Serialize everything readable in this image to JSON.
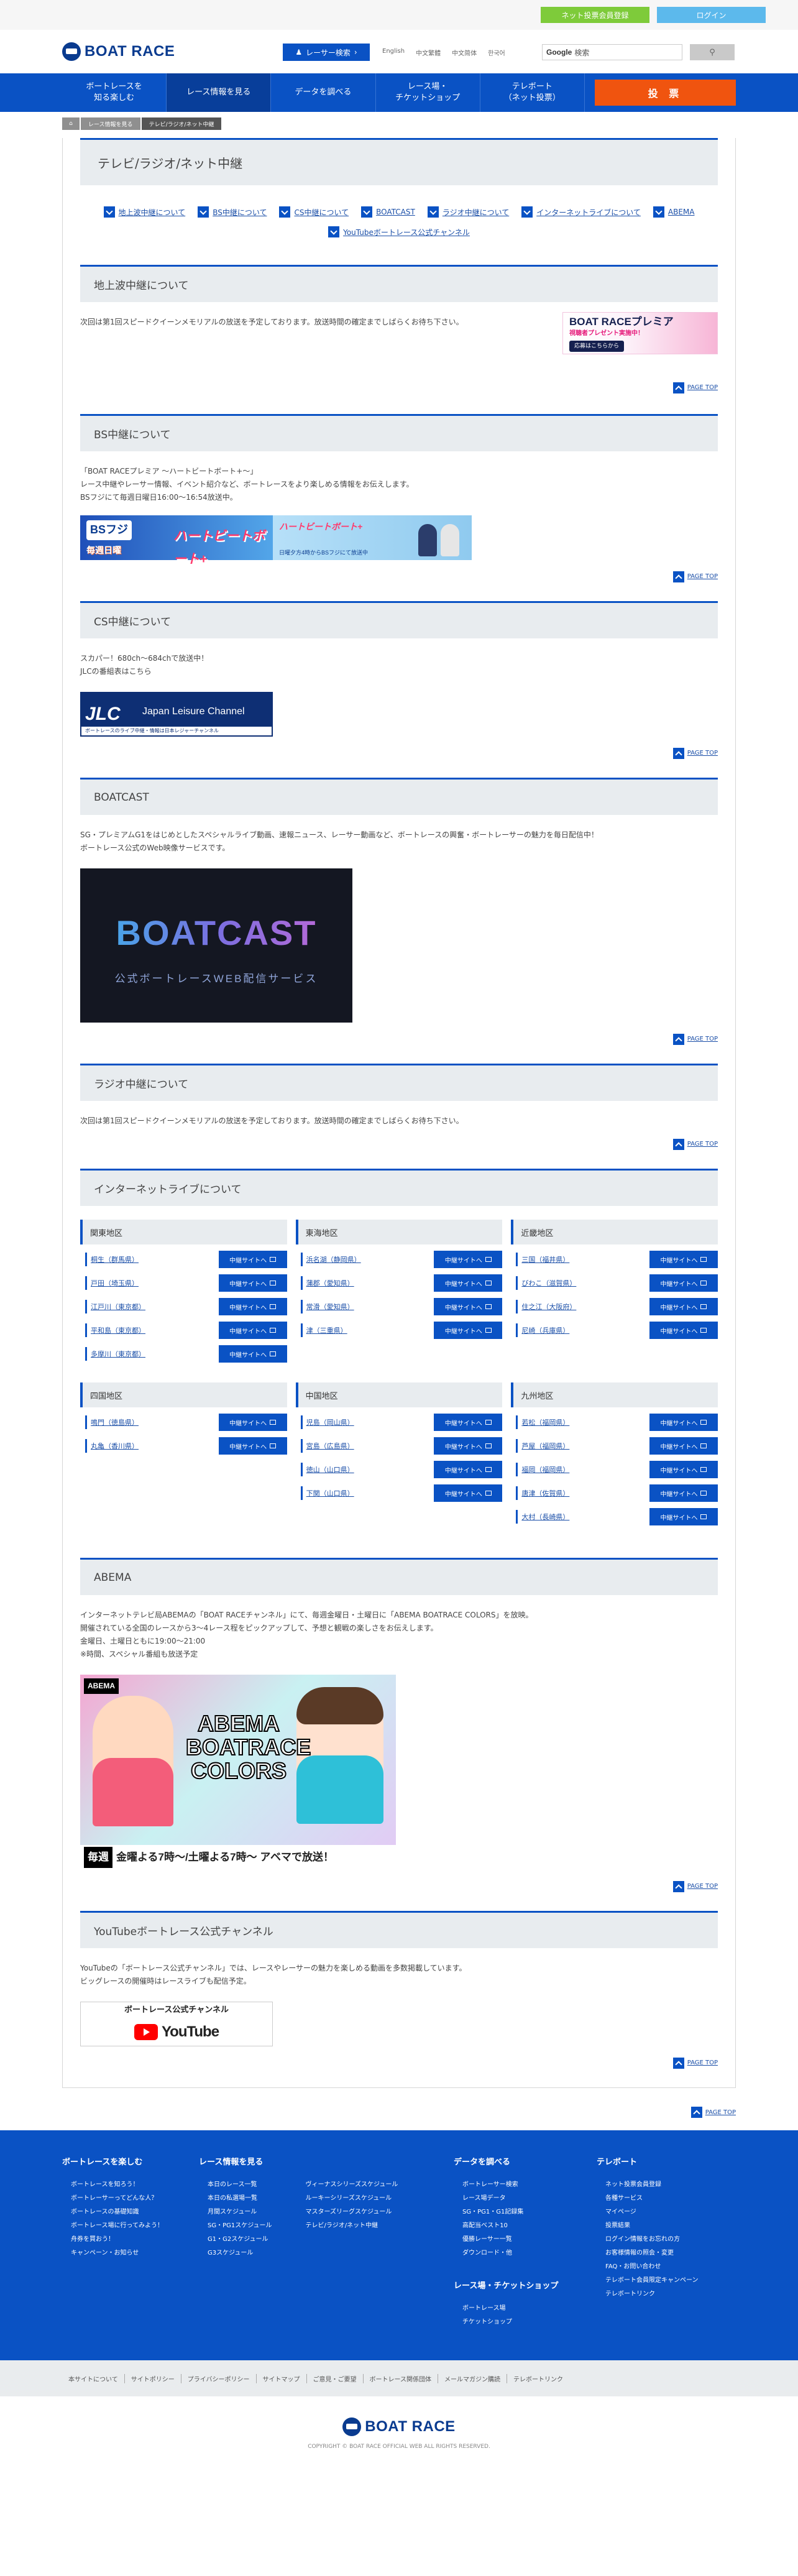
{
  "topbar": {
    "register": "ネット投票会員登録",
    "login": "ログイン"
  },
  "header": {
    "logo": "BOAT RACE",
    "racer_search": "レーサー検索",
    "langs": [
      "English",
      "中文繁體",
      "中文简体",
      "한국어"
    ],
    "google": "Google",
    "search_placeholder": "検索"
  },
  "nav": [
    {
      "label": "ボートレースを\n知る楽しむ"
    },
    {
      "label": "レース情報を見る"
    },
    {
      "label": "データを調べる"
    },
    {
      "label": "レース場・\nチケットショップ"
    },
    {
      "label": "テレボート\n（ネット投票）"
    }
  ],
  "nav_bet": "投 票",
  "breadcrumb": [
    "レース情報を見る",
    "テレビ/ラジオ/ネット中継"
  ],
  "page_title": "テレビ/ラジオ/ネット中継",
  "anchors": [
    "地上波中継について",
    "BS中継について",
    "CS中継について",
    "BOATCAST",
    "ラジオ中継について",
    "インターネットライブについて",
    "ABEMA",
    "YouTubeボートレース公式チャンネル"
  ],
  "page_top": "PAGE TOP",
  "sections": {
    "terrestrial": {
      "title": "地上波中継について",
      "text": "次回は第1回スピードクイーンメモリアルの放送を予定しております。放送時間の確定までしばらくお待ち下さい。",
      "banner": {
        "t1": "BOAT RACEプレミア",
        "t2": "視聴者プレゼント実施中！",
        "t3": "応募はこちらから"
      }
    },
    "bs": {
      "title": "BS中継について",
      "lines": [
        "「BOAT RACEプレミア ～ハートビートボート+～」",
        "レース中継やレーサー情報、イベント紹介など、ボートレースをより楽しめる情報をお伝えします。",
        "BSフジにて毎週日曜日16:00～16:54放送中。"
      ],
      "banner": {
        "bsf": "BSフジ",
        "sub": "毎週日曜",
        "ttl": "ハートビートボート+",
        "ttl2": "ハートビートボート+",
        "sub2": "日曜夕方4時からBSフジにて放送中"
      }
    },
    "cs": {
      "title": "CS中継について",
      "lines": [
        "スカパー！680ch～684chで放送中！",
        "JLCの番組表はこちら"
      ],
      "banner": {
        "mk": "JLC",
        "nm": "Japan Leisure Channel",
        "bar": "ボートレースのライブ中継・情報は日本レジャーチャンネル"
      }
    },
    "boatcast": {
      "title": "BOATCAST",
      "lines": [
        "SG・プレミアムG1をはじめとしたスペシャルライブ動画、速報ニュース、レーサー動画など、ボートレースの興奮・ボートレーサーの魅力を毎日配信中！",
        "ボートレース公式のWeb映像サービスです。"
      ],
      "banner": {
        "t1": "BOATCAST",
        "t2": "公式ボートレースWEB配信サービス"
      }
    },
    "radio": {
      "title": "ラジオ中継について",
      "text": "次回は第1回スピードクイーンメモリアルの放送を予定しております。放送時間の確定までしばらくお待ち下さい。"
    },
    "internet": {
      "title": "インターネットライブについて",
      "button": "中継サイトへ",
      "regions": [
        {
          "name": "関東地区",
          "stadiums": [
            "桐生（群馬県）",
            "戸田（埼玉県）",
            "江戸川（東京都）",
            "平和島（東京都）",
            "多摩川（東京都）"
          ]
        },
        {
          "name": "東海地区",
          "stadiums": [
            "浜名湖（静岡県）",
            "蒲郡（愛知県）",
            "常滑（愛知県）",
            "津（三重県）"
          ]
        },
        {
          "name": "近畿地区",
          "stadiums": [
            "三国（福井県）",
            "びわこ（滋賀県）",
            "住之江（大阪府）",
            "尼崎（兵庫県）"
          ]
        },
        {
          "name": "四国地区",
          "stadiums": [
            "鳴門（徳島県）",
            "丸亀（香川県）"
          ]
        },
        {
          "name": "中国地区",
          "stadiums": [
            "児島（岡山県）",
            "宮島（広島県）",
            "徳山（山口県）",
            "下関（山口県）"
          ]
        },
        {
          "name": "九州地区",
          "stadiums": [
            "若松（福岡県）",
            "芦屋（福岡県）",
            "福岡（福岡県）",
            "唐津（佐賀県）",
            "大村（長崎県）"
          ]
        }
      ]
    },
    "abema": {
      "title": "ABEMA",
      "lines": [
        "インターネットテレビ局ABEMAの「BOAT RACEチャンネル」にて、毎週金曜日・土曜日に「ABEMA BOATRACE COLORS」を放映。",
        "開催されている全国のレースから3～4レース程をピックアップして、予想と観戦の楽しさをお伝えします。",
        "金曜日、土曜日ともに19:00～21:00",
        "※時間、スペシャル番組も放送予定"
      ],
      "banner": {
        "logo": "ABEMA",
        "tt": "ABEMA BOATRACE COLORS",
        "mai": "毎週",
        "strip": "金曜よる7時～/土曜よる7時～ アベマで放送！"
      }
    },
    "youtube": {
      "title": "YouTubeボートレース公式チャンネル",
      "lines": [
        "YouTubeの「ボートレース公式チャンネル」では、レースやレーサーの魅力を楽しめる動画を多数掲載しています。",
        "ビッグレースの開催時はレースライブも配信予定。"
      ],
      "banner": {
        "t1": "ボートレース公式チャンネル",
        "yt": "YouTube"
      }
    }
  },
  "footer": {
    "col1": {
      "title": "ボートレースを楽しむ",
      "items": [
        "ボートレースを知ろう！",
        "ボートレーサーってどんな人？",
        "ボートレースの基礎知識",
        "ボートレース場に行ってみよう！",
        "舟券を買おう！",
        "キャンペーン・お知らせ"
      ]
    },
    "col2": {
      "title": "レース情報を見る",
      "left": [
        "本日のレース一覧",
        "本日の私選場一覧",
        "月間スケジュール",
        "SG・PG1スケジュール",
        "G1・G2スケジュール",
        "G3スケジュール"
      ],
      "right": [
        "ヴィーナスシリーズスケジュール",
        "ルーキーシリーズスケジュール",
        "マスターズリーグスケジュール",
        "テレビ/ラジオ/ネット中継"
      ]
    },
    "col3": {
      "title": "データを調べる",
      "items": [
        "ボートレーサー検索",
        "レース場データ",
        "SG・PG1・G1記録集",
        "高配当ベスト10",
        "優勝レーサー一覧",
        "ダウンロード・他"
      ],
      "title2": "レース場・チケットショップ",
      "items2": [
        "ボートレース場",
        "チケットショップ"
      ]
    },
    "col4": {
      "title": "テレボート",
      "items": [
        "ネット投票会員登録",
        "各種サービス",
        "マイページ",
        "投票結果",
        "ログイン情報をお忘れの方",
        "お客様情報の照会・変更",
        "FAQ・お問い合わせ",
        "テレボート会員限定キャンペーン",
        "テレボートリンク"
      ]
    }
  },
  "subfooter": [
    "本サイトについて",
    "サイトポリシー",
    "プライバシーポリシー",
    "サイトマップ",
    "ご意見・ご要望",
    "ボートレース関係団体",
    "メールマガジン購読",
    "テレボートリンク"
  ],
  "copyright": "COPYRIGHT © BOAT RACE OFFICIAL WEB ALL RIGHTS RESERVED."
}
